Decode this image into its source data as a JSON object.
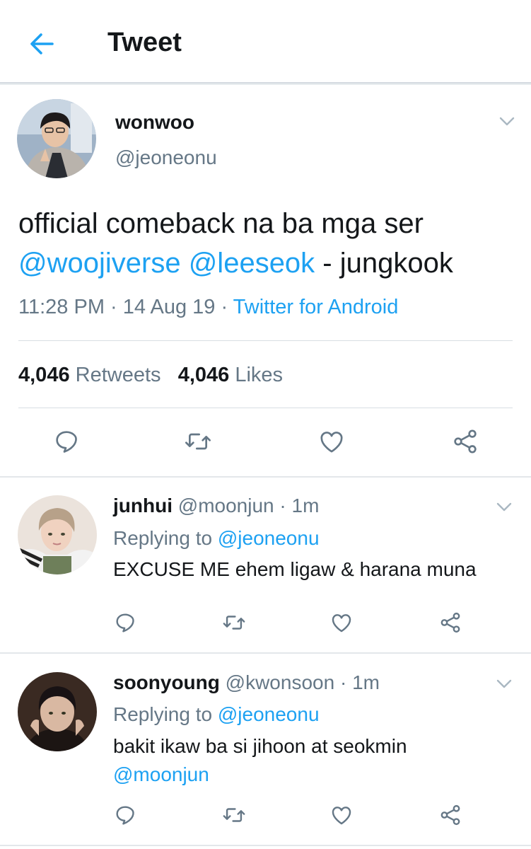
{
  "header": {
    "title": "Tweet"
  },
  "tweet": {
    "name": "wonwoo",
    "handle": "@jeoneonu",
    "text_plain": "official comeback na ba mga ser",
    "mentions": [
      "@woojiverse",
      "@leeseok"
    ],
    "text_suffix": " - jungkook",
    "time": "11:28 PM",
    "date": "14 Aug 19",
    "source": "Twitter for Android",
    "retweets_count": "4,046",
    "retweets_label": "Retweets",
    "likes_count": "4,046",
    "likes_label": "Likes"
  },
  "replies": [
    {
      "name": "junhui",
      "handle": "@moonjun",
      "age": "1m",
      "replying_label": "Replying to",
      "replying_to": "@jeoneonu",
      "text": "EXCUSE ME ehem ligaw & harana muna"
    },
    {
      "name": "soonyoung",
      "handle": "@kwonsoon",
      "age": "1m",
      "replying_label": "Replying to",
      "replying_to": "@jeoneonu",
      "text": "bakit ikaw ba si jihoon at seokmin",
      "mention": "@moonjun"
    }
  ],
  "icons": {
    "back": "arrow-left-icon",
    "reply": "reply-icon",
    "retweet": "retweet-icon",
    "like": "heart-icon",
    "share": "share-icon",
    "more": "chevron-down-icon"
  },
  "colors": {
    "accent": "#1da1f2",
    "secondary": "#657786",
    "text": "#14171a"
  }
}
